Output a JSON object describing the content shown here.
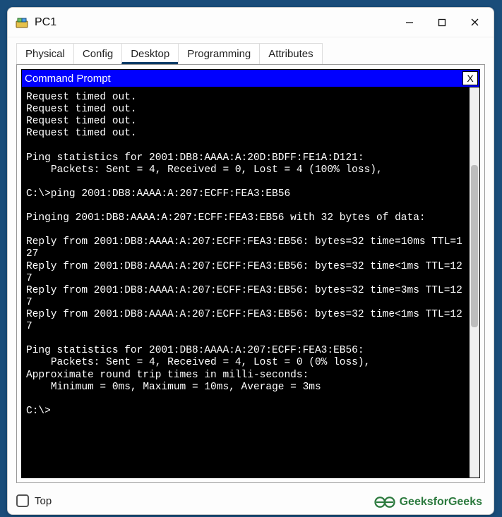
{
  "window": {
    "title": "PC1"
  },
  "tabs": {
    "items": [
      {
        "label": "Physical"
      },
      {
        "label": "Config"
      },
      {
        "label": "Desktop"
      },
      {
        "label": "Programming"
      },
      {
        "label": "Attributes"
      }
    ],
    "active_index": 2
  },
  "panel": {
    "title": "Command Prompt",
    "close_label": "X"
  },
  "terminal": {
    "lines": [
      "Request timed out.",
      "Request timed out.",
      "Request timed out.",
      "Request timed out.",
      "",
      "Ping statistics for 2001:DB8:AAAA:A:20D:BDFF:FE1A:D121:",
      "    Packets: Sent = 4, Received = 0, Lost = 4 (100% loss),",
      "",
      "C:\\>ping 2001:DB8:AAAA:A:207:ECFF:FEA3:EB56",
      "",
      "Pinging 2001:DB8:AAAA:A:207:ECFF:FEA3:EB56 with 32 bytes of data:",
      "",
      "Reply from 2001:DB8:AAAA:A:207:ECFF:FEA3:EB56: bytes=32 time=10ms TTL=127",
      "Reply from 2001:DB8:AAAA:A:207:ECFF:FEA3:EB56: bytes=32 time<1ms TTL=127",
      "Reply from 2001:DB8:AAAA:A:207:ECFF:FEA3:EB56: bytes=32 time=3ms TTL=127",
      "Reply from 2001:DB8:AAAA:A:207:ECFF:FEA3:EB56: bytes=32 time<1ms TTL=127",
      "",
      "Ping statistics for 2001:DB8:AAAA:A:207:ECFF:FEA3:EB56:",
      "    Packets: Sent = 4, Received = 4, Lost = 0 (0% loss),",
      "Approximate round trip times in milli-seconds:",
      "    Minimum = 0ms, Maximum = 10ms, Average = 3ms",
      "",
      "C:\\>"
    ]
  },
  "footer": {
    "top_label": "Top"
  },
  "watermark": {
    "text": "GeeksforGeeks"
  }
}
